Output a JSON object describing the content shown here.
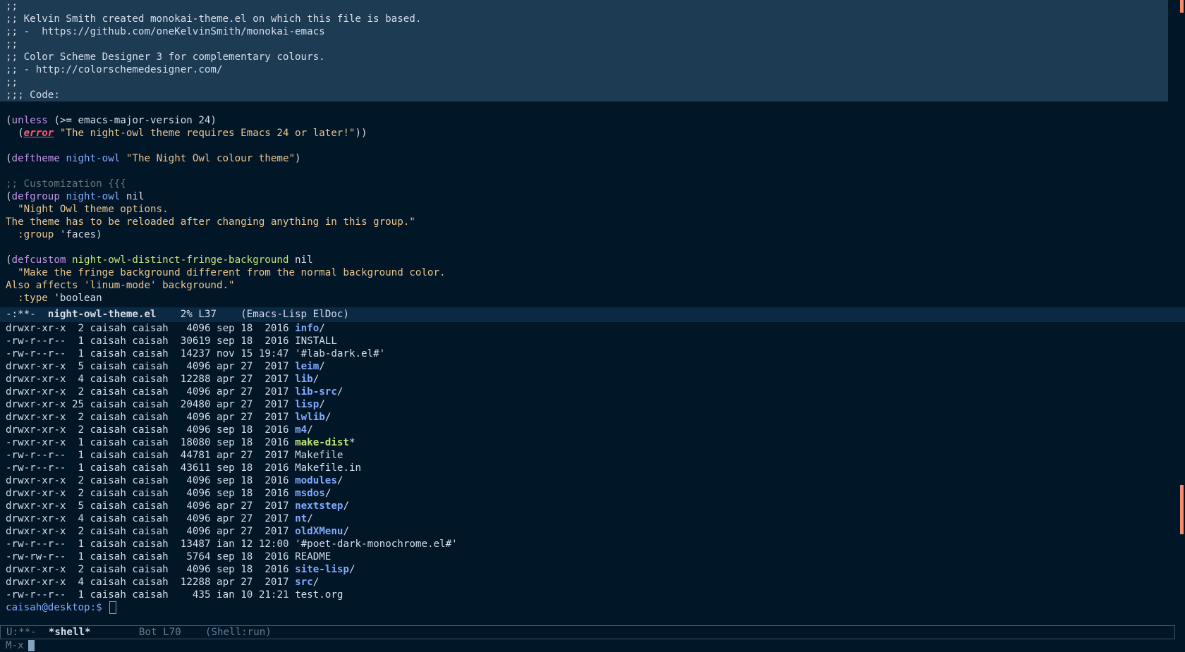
{
  "editor": {
    "lines": [
      {
        "hl": true,
        "segments": [
          {
            "c": "c-default",
            "t": ";;"
          }
        ]
      },
      {
        "hl": true,
        "segments": [
          {
            "c": "c-default",
            "t": ";; Kelvin Smith created monokai-theme.el on which this file is based."
          }
        ]
      },
      {
        "hl": true,
        "segments": [
          {
            "c": "c-default",
            "t": ";; -  https://github.com/oneKelvinSmith/monokai-emacs"
          }
        ]
      },
      {
        "hl": true,
        "segments": [
          {
            "c": "c-default",
            "t": ";;"
          }
        ]
      },
      {
        "hl": true,
        "segments": [
          {
            "c": "c-default",
            "t": ";; Color Scheme Designer 3 for complementary colours."
          }
        ]
      },
      {
        "hl": true,
        "segments": [
          {
            "c": "c-default",
            "t": ";; - http://colorschemedesigner.com/"
          }
        ]
      },
      {
        "hl": true,
        "segments": [
          {
            "c": "c-default",
            "t": ";;"
          }
        ]
      },
      {
        "hl": true,
        "segments": [
          {
            "c": "c-default",
            "t": ";;; Code:"
          }
        ]
      },
      {
        "hl": false,
        "segments": [
          {
            "c": "c-default",
            "t": ""
          }
        ]
      },
      {
        "hl": false,
        "segments": [
          {
            "c": "c-default",
            "t": "("
          },
          {
            "c": "c-kw",
            "t": "unless"
          },
          {
            "c": "c-default",
            "t": " (>= emacs-major-version 24)"
          }
        ]
      },
      {
        "hl": false,
        "segments": [
          {
            "c": "c-default",
            "t": "  ("
          },
          {
            "c": "c-err",
            "t": "error"
          },
          {
            "c": "c-default",
            "t": " "
          },
          {
            "c": "c-str",
            "t": "\"The night-owl theme requires Emacs 24 or later!\""
          },
          {
            "c": "c-default",
            "t": "))"
          }
        ]
      },
      {
        "hl": false,
        "segments": [
          {
            "c": "c-default",
            "t": ""
          }
        ]
      },
      {
        "hl": false,
        "segments": [
          {
            "c": "c-default",
            "t": "("
          },
          {
            "c": "c-kw",
            "t": "deftheme"
          },
          {
            "c": "c-default",
            "t": " "
          },
          {
            "c": "c-fn",
            "t": "night-owl"
          },
          {
            "c": "c-default",
            "t": " "
          },
          {
            "c": "c-str",
            "t": "\"The Night Owl colour theme\""
          },
          {
            "c": "c-default",
            "t": ")"
          }
        ]
      },
      {
        "hl": false,
        "segments": [
          {
            "c": "c-default",
            "t": ""
          }
        ]
      },
      {
        "hl": false,
        "segments": [
          {
            "c": "c-comment",
            "t": ";; Customization {{{"
          }
        ]
      },
      {
        "hl": false,
        "segments": [
          {
            "c": "c-default",
            "t": "("
          },
          {
            "c": "c-kw",
            "t": "defgroup"
          },
          {
            "c": "c-default",
            "t": " "
          },
          {
            "c": "c-fn",
            "t": "night-owl"
          },
          {
            "c": "c-default",
            "t": " nil"
          }
        ]
      },
      {
        "hl": false,
        "segments": [
          {
            "c": "c-str",
            "t": "  \"Night Owl theme options."
          }
        ]
      },
      {
        "hl": false,
        "segments": [
          {
            "c": "c-str",
            "t": "The theme has to be reloaded after changing anything in this group.\""
          }
        ]
      },
      {
        "hl": false,
        "segments": [
          {
            "c": "c-default",
            "t": "  "
          },
          {
            "c": "c-str",
            "t": ":group"
          },
          {
            "c": "c-default",
            "t": " 'faces)"
          }
        ]
      },
      {
        "hl": false,
        "segments": [
          {
            "c": "c-default",
            "t": ""
          }
        ]
      },
      {
        "hl": false,
        "segments": [
          {
            "c": "c-default",
            "t": "("
          },
          {
            "c": "c-kw",
            "t": "defcustom"
          },
          {
            "c": "c-default",
            "t": " "
          },
          {
            "c": "c-var",
            "t": "night-owl-distinct-fringe-background"
          },
          {
            "c": "c-default",
            "t": " nil"
          }
        ]
      },
      {
        "hl": false,
        "segments": [
          {
            "c": "c-str",
            "t": "  \"Make the fringe background different from the normal background color."
          }
        ]
      },
      {
        "hl": false,
        "segments": [
          {
            "c": "c-str",
            "t": "Also affects 'linum-mode' background.\""
          }
        ]
      },
      {
        "hl": false,
        "segments": [
          {
            "c": "c-default",
            "t": "  "
          },
          {
            "c": "c-str",
            "t": ":type"
          },
          {
            "c": "c-default",
            "t": " 'boolean"
          }
        ]
      }
    ]
  },
  "modeline_top": {
    "status": "-:**-  ",
    "buffer": "night-owl-theme.el",
    "position": "    2% L37    ",
    "modes": "(Emacs-Lisp ElDoc)"
  },
  "shell": {
    "rows": [
      {
        "perm": "drwxr-xr-x",
        "links": " 2",
        "user": "caisah",
        "group": "caisah",
        "size": "4096",
        "date": "sep 18  2016",
        "name": "info",
        "suffix": "/",
        "kind": "dir"
      },
      {
        "perm": "-rw-r--r--",
        "links": " 1",
        "user": "caisah",
        "group": "caisah",
        "size": "30619",
        "date": "sep 18  2016",
        "name": "INSTALL",
        "suffix": "",
        "kind": "file"
      },
      {
        "perm": "-rw-r--r--",
        "links": " 1",
        "user": "caisah",
        "group": "caisah",
        "size": "14237",
        "date": "nov 15 19:47",
        "name": "'#lab-dark.el#'",
        "suffix": "",
        "kind": "file"
      },
      {
        "perm": "drwxr-xr-x",
        "links": " 5",
        "user": "caisah",
        "group": "caisah",
        "size": "4096",
        "date": "apr 27  2017",
        "name": "leim",
        "suffix": "/",
        "kind": "dir"
      },
      {
        "perm": "drwxr-xr-x",
        "links": " 4",
        "user": "caisah",
        "group": "caisah",
        "size": "12288",
        "date": "apr 27  2017",
        "name": "lib",
        "suffix": "/",
        "kind": "dir"
      },
      {
        "perm": "drwxr-xr-x",
        "links": " 2",
        "user": "caisah",
        "group": "caisah",
        "size": "4096",
        "date": "apr 27  2017",
        "name": "lib-src",
        "suffix": "/",
        "kind": "dir"
      },
      {
        "perm": "drwxr-xr-x",
        "links": "25",
        "user": "caisah",
        "group": "caisah",
        "size": "20480",
        "date": "apr 27  2017",
        "name": "lisp",
        "suffix": "/",
        "kind": "dir"
      },
      {
        "perm": "drwxr-xr-x",
        "links": " 2",
        "user": "caisah",
        "group": "caisah",
        "size": "4096",
        "date": "apr 27  2017",
        "name": "lwlib",
        "suffix": "/",
        "kind": "dir"
      },
      {
        "perm": "drwxr-xr-x",
        "links": " 2",
        "user": "caisah",
        "group": "caisah",
        "size": "4096",
        "date": "sep 18  2016",
        "name": "m4",
        "suffix": "/",
        "kind": "dir"
      },
      {
        "perm": "-rwxr-xr-x",
        "links": " 1",
        "user": "caisah",
        "group": "caisah",
        "size": "18080",
        "date": "sep 18  2016",
        "name": "make-dist",
        "suffix": "*",
        "kind": "exec"
      },
      {
        "perm": "-rw-r--r--",
        "links": " 1",
        "user": "caisah",
        "group": "caisah",
        "size": "44781",
        "date": "apr 27  2017",
        "name": "Makefile",
        "suffix": "",
        "kind": "file"
      },
      {
        "perm": "-rw-r--r--",
        "links": " 1",
        "user": "caisah",
        "group": "caisah",
        "size": "43611",
        "date": "sep 18  2016",
        "name": "Makefile.in",
        "suffix": "",
        "kind": "file"
      },
      {
        "perm": "drwxr-xr-x",
        "links": " 2",
        "user": "caisah",
        "group": "caisah",
        "size": "4096",
        "date": "sep 18  2016",
        "name": "modules",
        "suffix": "/",
        "kind": "dir"
      },
      {
        "perm": "drwxr-xr-x",
        "links": " 2",
        "user": "caisah",
        "group": "caisah",
        "size": "4096",
        "date": "sep 18  2016",
        "name": "msdos",
        "suffix": "/",
        "kind": "dir"
      },
      {
        "perm": "drwxr-xr-x",
        "links": " 5",
        "user": "caisah",
        "group": "caisah",
        "size": "4096",
        "date": "apr 27  2017",
        "name": "nextstep",
        "suffix": "/",
        "kind": "dir"
      },
      {
        "perm": "drwxr-xr-x",
        "links": " 4",
        "user": "caisah",
        "group": "caisah",
        "size": "4096",
        "date": "apr 27  2017",
        "name": "nt",
        "suffix": "/",
        "kind": "dir"
      },
      {
        "perm": "drwxr-xr-x",
        "links": " 2",
        "user": "caisah",
        "group": "caisah",
        "size": "4096",
        "date": "apr 27  2017",
        "name": "oldXMenu",
        "suffix": "/",
        "kind": "dir"
      },
      {
        "perm": "-rw-r--r--",
        "links": " 1",
        "user": "caisah",
        "group": "caisah",
        "size": "13487",
        "date": "ian 12 12:00",
        "name": "'#poet-dark-monochrome.el#'",
        "suffix": "",
        "kind": "file"
      },
      {
        "perm": "-rw-rw-r--",
        "links": " 1",
        "user": "caisah",
        "group": "caisah",
        "size": "5764",
        "date": "sep 18  2016",
        "name": "README",
        "suffix": "",
        "kind": "file"
      },
      {
        "perm": "drwxr-xr-x",
        "links": " 2",
        "user": "caisah",
        "group": "caisah",
        "size": "4096",
        "date": "sep 18  2016",
        "name": "site-lisp",
        "suffix": "/",
        "kind": "dir"
      },
      {
        "perm": "drwxr-xr-x",
        "links": " 4",
        "user": "caisah",
        "group": "caisah",
        "size": "12288",
        "date": "apr 27  2017",
        "name": "src",
        "suffix": "/",
        "kind": "dir"
      },
      {
        "perm": "-rw-r--r--",
        "links": " 1",
        "user": "caisah",
        "group": "caisah",
        "size": "435",
        "date": "ian 10 21:21",
        "name": "test.org",
        "suffix": "",
        "kind": "file"
      }
    ],
    "prompt": "caisah@desktop:$ "
  },
  "modeline_bottom": {
    "status": "U:**-  ",
    "buffer": "*shell*",
    "position": "        Bot L70    ",
    "modes": "(Shell:run)"
  },
  "minibuffer": {
    "text": "M-x"
  }
}
